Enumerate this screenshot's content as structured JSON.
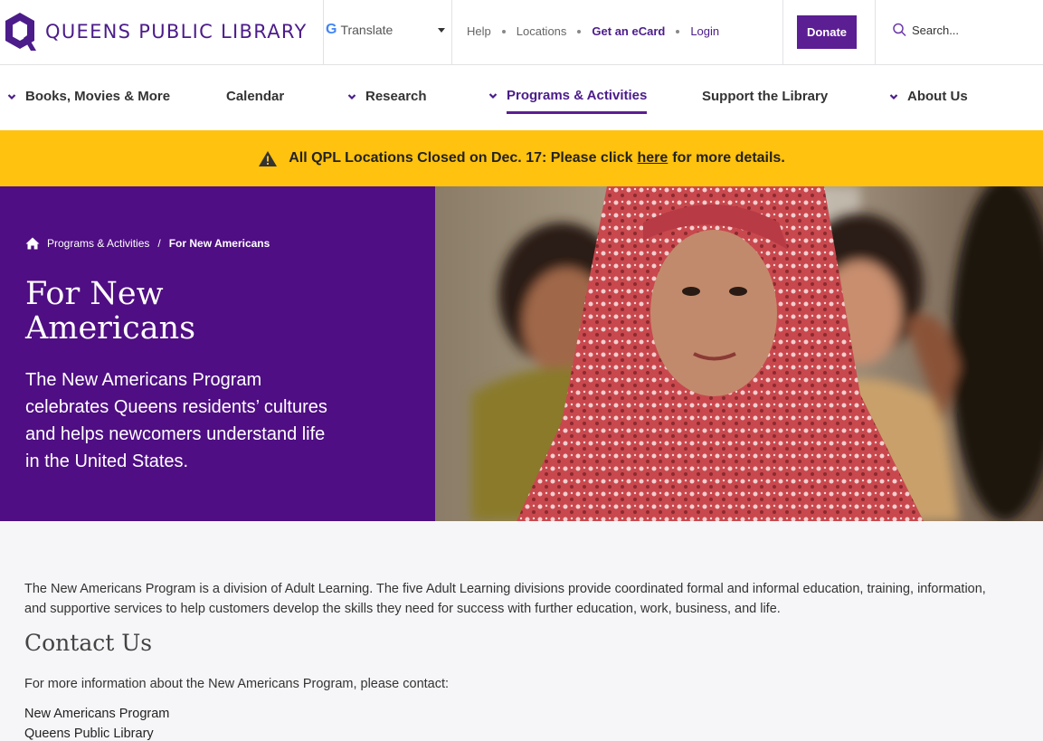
{
  "header": {
    "logo_text": "QUEENS PUBLIC LIBRARY",
    "translate_label": "Translate",
    "links": {
      "help": "Help",
      "locations": "Locations",
      "ecard": "Get an eCard",
      "login": "Login"
    },
    "donate_label": "Donate",
    "search_placeholder": "Search..."
  },
  "nav": {
    "items": [
      {
        "label": "Books, Movies & More"
      },
      {
        "label": "Calendar"
      },
      {
        "label": "Research"
      },
      {
        "label": "Programs & Activities"
      },
      {
        "label": "Support the Library"
      },
      {
        "label": "About Us"
      }
    ]
  },
  "alert": {
    "prefix": "All QPL Locations Closed on Dec. 17: Please click",
    "link": "here",
    "suffix": "for more details."
  },
  "hero": {
    "breadcrumb_parent": "Programs & Activities",
    "breadcrumb_sep": "/",
    "breadcrumb_current": "For New Americans",
    "title": "For New Americans",
    "description": "The New Americans Program celebrates Queens residents’ cultures and helps newcomers understand life in the United States."
  },
  "content": {
    "intro": "The New Americans Program is a division of Adult Learning. The five Adult Learning divisions provide coordinated formal and informal education, training, information, and supportive services to help customers develop the skills they need for success with further education, work, business, and life.",
    "contact_heading": "Contact Us",
    "contact_text": "For more information about the New Americans Program, please contact:",
    "address_line1": "New Americans Program",
    "address_line2": "Queens Public Library"
  },
  "colors": {
    "brand_purple": "#4f0e83",
    "accent_purple": "#5c1e93",
    "alert_yellow": "#ffc20e"
  },
  "icons": {
    "logo": "qpl-logo-icon",
    "google": "google-g-icon",
    "search": "search-icon",
    "chevron": "chevron-down-icon",
    "warning": "warning-icon",
    "home": "home-icon"
  }
}
